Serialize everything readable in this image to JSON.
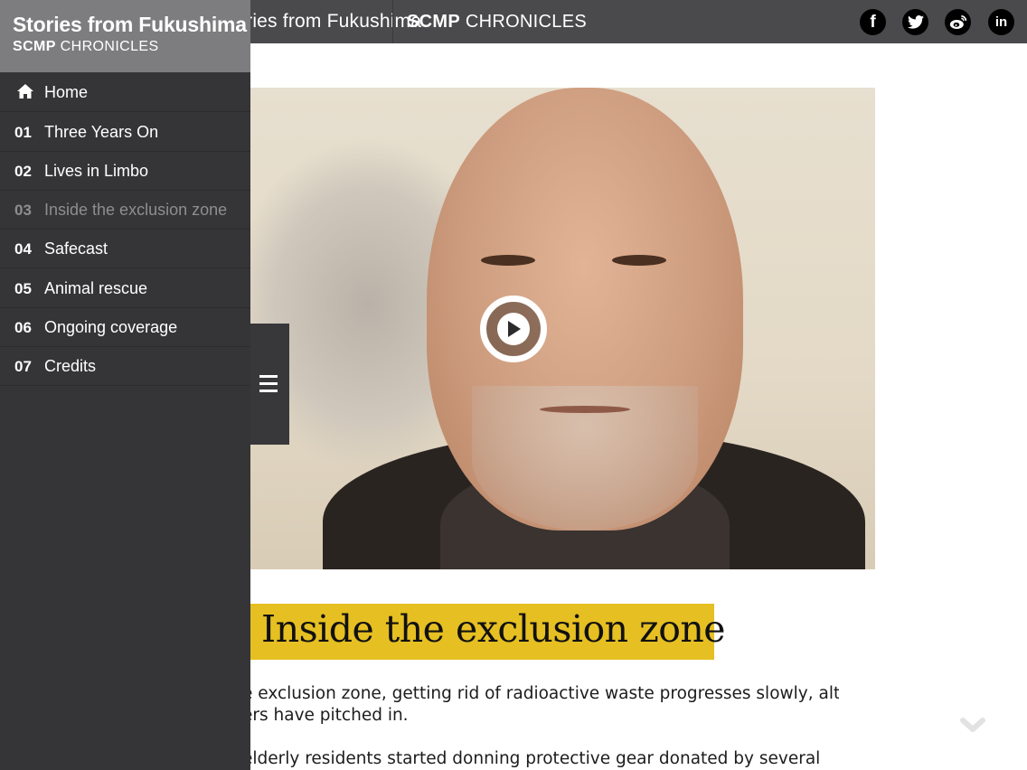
{
  "topbar": {
    "title": "Stories from Fukushima",
    "brand_bold": "SCMP",
    "brand_light": " CHRONICLES",
    "social": [
      {
        "icon": "facebook-icon",
        "glyph": "f"
      },
      {
        "icon": "twitter-icon"
      },
      {
        "icon": "weibo-icon"
      },
      {
        "icon": "linkedin-icon",
        "glyph": "in"
      }
    ]
  },
  "sidebar": {
    "title": "Stories from Fukushima",
    "brand_bold": "SCMP",
    "brand_light": " CHRONICLES",
    "items": [
      {
        "num": "",
        "label": "Home",
        "icon": "home-icon",
        "active": false
      },
      {
        "num": "01",
        "label": "Three Years On",
        "active": false
      },
      {
        "num": "02",
        "label": "Lives in Limbo",
        "active": false
      },
      {
        "num": "03",
        "label": "Inside the exclusion zone",
        "active": true
      },
      {
        "num": "04",
        "label": "Safecast",
        "active": false
      },
      {
        "num": "05",
        "label": "Animal rescue",
        "active": false
      },
      {
        "num": "06",
        "label": "Ongoing coverage",
        "active": false
      },
      {
        "num": "07",
        "label": "Credits",
        "active": false
      }
    ]
  },
  "article": {
    "headline": "Inside the exclusion zone",
    "paragraph1_line1": "e exclusion zone, getting rid of radioactive waste progresses slowly, although",
    "paragraph1_line2": "ers have pitched in.",
    "paragraph2_line1": "elderly residents started donning protective gear donated by several"
  },
  "colors": {
    "topbar": "#4a4a4c",
    "sidebar": "#353537",
    "sidebar_header": "#7d7d7f",
    "headline_highlight": "#e6bf22"
  }
}
